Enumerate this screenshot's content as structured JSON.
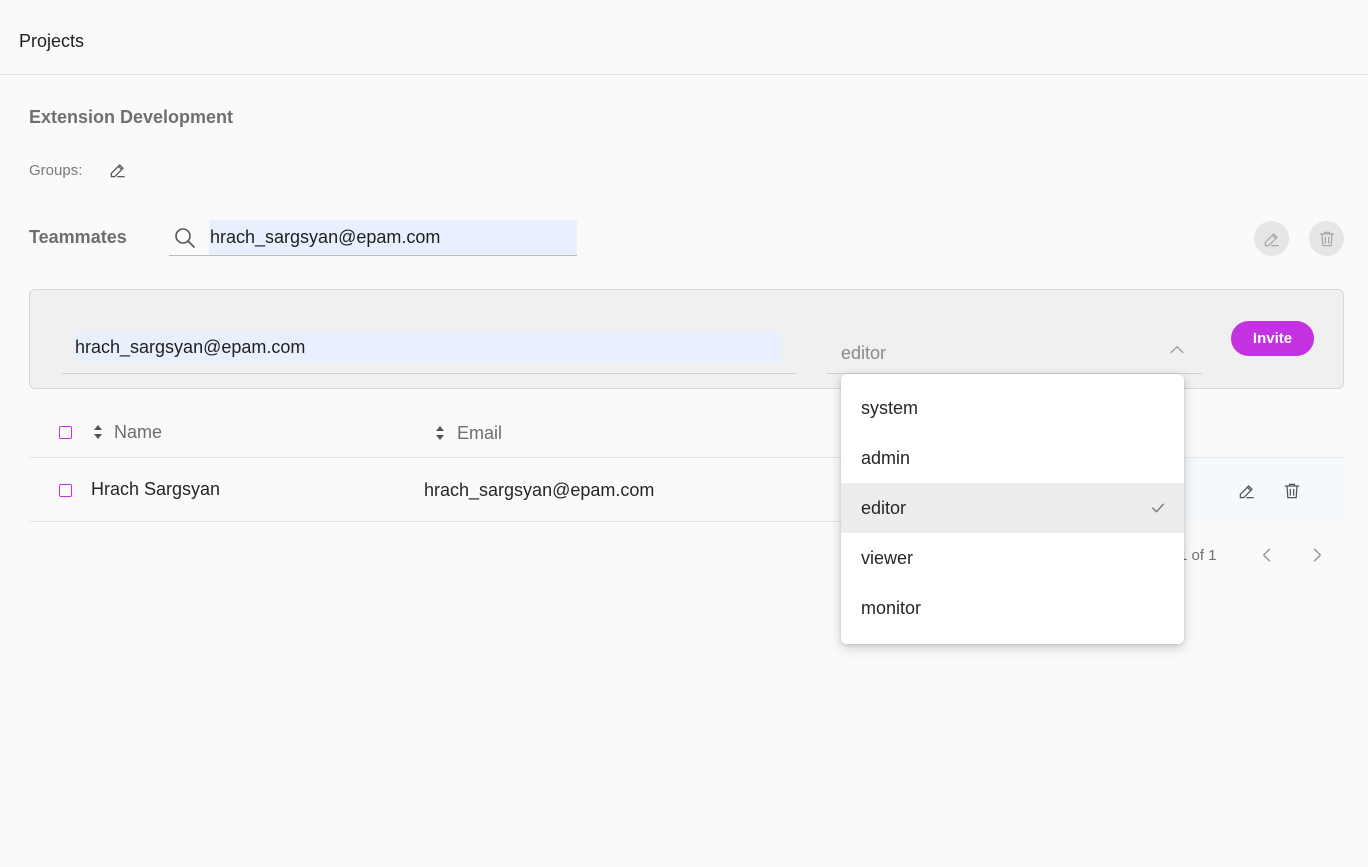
{
  "header": {
    "title": "Projects"
  },
  "project": {
    "name": "Extension Development",
    "groups_label": "Groups:"
  },
  "teammates": {
    "label": "Teammates",
    "search_value": "hrach_sargsyan@epam.com"
  },
  "invite": {
    "email_value": "hrach_sargsyan@epam.com",
    "role_value": "editor",
    "button_label": "Invite"
  },
  "table": {
    "columns": [
      "Name",
      "Email"
    ],
    "rows": [
      {
        "name": "Hrach Sargsyan",
        "email": "hrach_sargsyan@epam.com"
      }
    ]
  },
  "pagination": {
    "text": "1 of 1"
  },
  "role_dropdown": {
    "options": [
      "system",
      "admin",
      "editor",
      "viewer",
      "monitor"
    ],
    "selected": "editor"
  },
  "colors": {
    "accent": "#c431e0",
    "autofill_bg": "#e8f0fe",
    "panel_bg": "#f0f0f0"
  }
}
